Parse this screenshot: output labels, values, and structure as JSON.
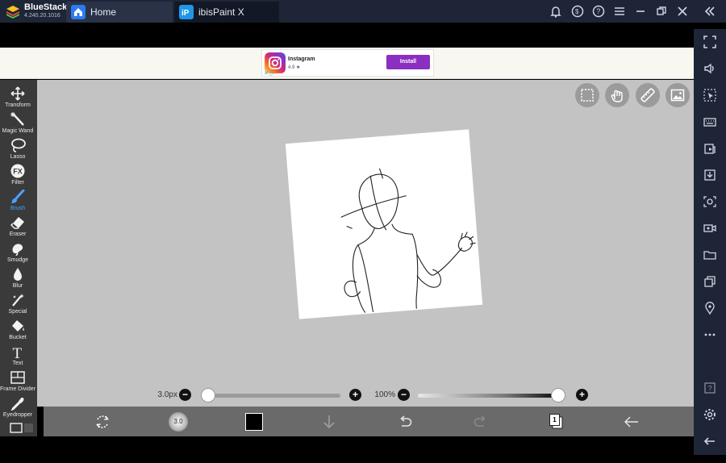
{
  "window": {
    "app_name": "BlueStacks",
    "app_version": "4.240.20.1016",
    "tabs": [
      {
        "label": "Home",
        "active": false,
        "icon": "home-icon"
      },
      {
        "label": "ibisPaint X",
        "active": true,
        "icon": "ibispaint-icon"
      }
    ],
    "controls": [
      "bell-icon",
      "account-icon",
      "help-icon",
      "menu-icon",
      "minimize-icon",
      "restore-icon",
      "close-icon",
      "collapse-sidebar-icon"
    ]
  },
  "ad": {
    "app_title": "Instagram",
    "rating": "4.9 ★",
    "install_label": "Install",
    "choices_label": "✕ ▷"
  },
  "left_toolbar": {
    "tools": [
      {
        "label": "Transform",
        "icon": "transform-icon"
      },
      {
        "label": "Magic Wand",
        "icon": "magic-wand-icon"
      },
      {
        "label": "Lasso",
        "icon": "lasso-icon"
      },
      {
        "label": "Filter",
        "icon": "filter-fx-icon"
      },
      {
        "label": "Brush",
        "icon": "brush-icon",
        "active": true
      },
      {
        "label": "Eraser",
        "icon": "eraser-icon"
      },
      {
        "label": "Smudge",
        "icon": "smudge-icon"
      },
      {
        "label": "Blur",
        "icon": "blur-icon"
      },
      {
        "label": "Special",
        "icon": "special-icon"
      },
      {
        "label": "Bucket",
        "icon": "bucket-icon"
      },
      {
        "label": "Text",
        "icon": "text-icon"
      },
      {
        "label": "Frame Divider",
        "icon": "frame-divider-icon"
      },
      {
        "label": "Eyedropper",
        "icon": "eyedropper-icon"
      }
    ]
  },
  "sliders": {
    "brush_size_label": "3.0px",
    "brush_size_fraction": 0.0,
    "opacity_label": "100%",
    "opacity_fraction": 1.0,
    "minus": "−",
    "plus": "+"
  },
  "bottom_toolbar": {
    "brush_size_text": "3.0",
    "current_color": "#000000",
    "layer_count": "1"
  },
  "colors": {
    "accent": "#4aa3ff",
    "canvas_bg": "#c3c3c3",
    "chrome": "#1e2536",
    "install_button": "#8b2fc0"
  }
}
